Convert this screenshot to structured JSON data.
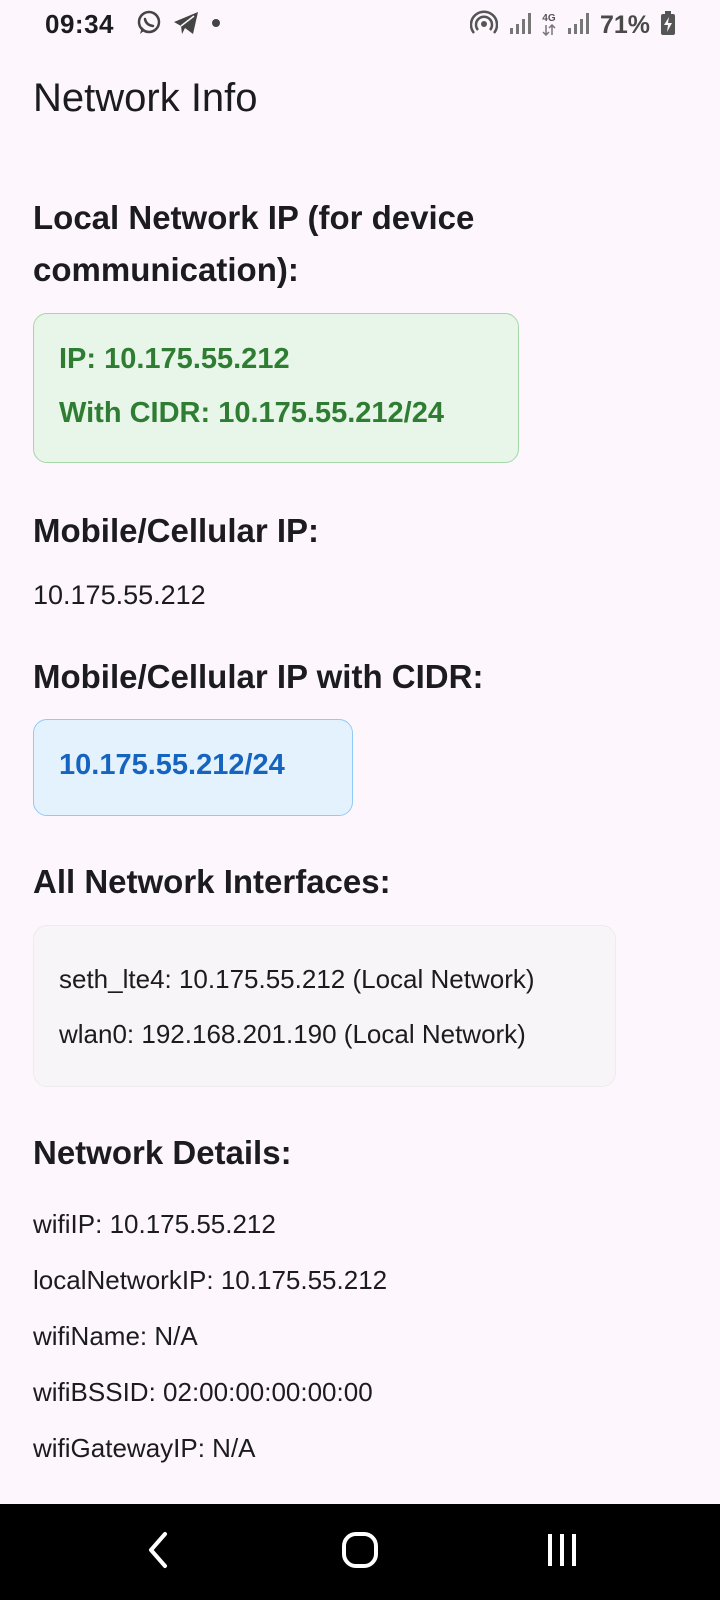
{
  "status_bar": {
    "time": "09:34",
    "battery": "71%",
    "network_type": "4G",
    "icons": [
      "whatsapp-icon",
      "telegram-icon",
      "dot-icon",
      "hotspot-icon",
      "signal-icon",
      "signal-icon",
      "battery-charging-icon"
    ]
  },
  "app_bar": {
    "title": "Network Info"
  },
  "local_network": {
    "title": "Local Network IP (for device communication):",
    "ip_line": "IP: 10.175.55.212",
    "cidr_line": "With CIDR: 10.175.55.212/24"
  },
  "mobile_ip": {
    "title": "Mobile/Cellular IP:",
    "value": "10.175.55.212"
  },
  "mobile_cidr": {
    "title": "Mobile/Cellular IP with CIDR:",
    "value": "10.175.55.212/24"
  },
  "interfaces": {
    "title": "All Network Interfaces:",
    "items": [
      "seth_lte4: 10.175.55.212 (Local Network)",
      "wlan0: 192.168.201.190 (Local Network)"
    ]
  },
  "details": {
    "title": "Network Details:",
    "items": [
      "wifiIP: 10.175.55.212",
      "localNetworkIP: 10.175.55.212",
      "wifiName: N/A",
      "wifiBSSID: 02:00:00:00:00:00",
      "wifiGatewayIP: N/A"
    ]
  },
  "colors": {
    "background": "#fdf7fd",
    "green_text": "#2e7d32",
    "green_bg": "#e8f5e9",
    "blue_text": "#1565c0",
    "blue_bg": "#e3f2fd"
  },
  "nav_bar": {
    "buttons": [
      "back-icon",
      "home-icon",
      "recents-icon"
    ]
  }
}
